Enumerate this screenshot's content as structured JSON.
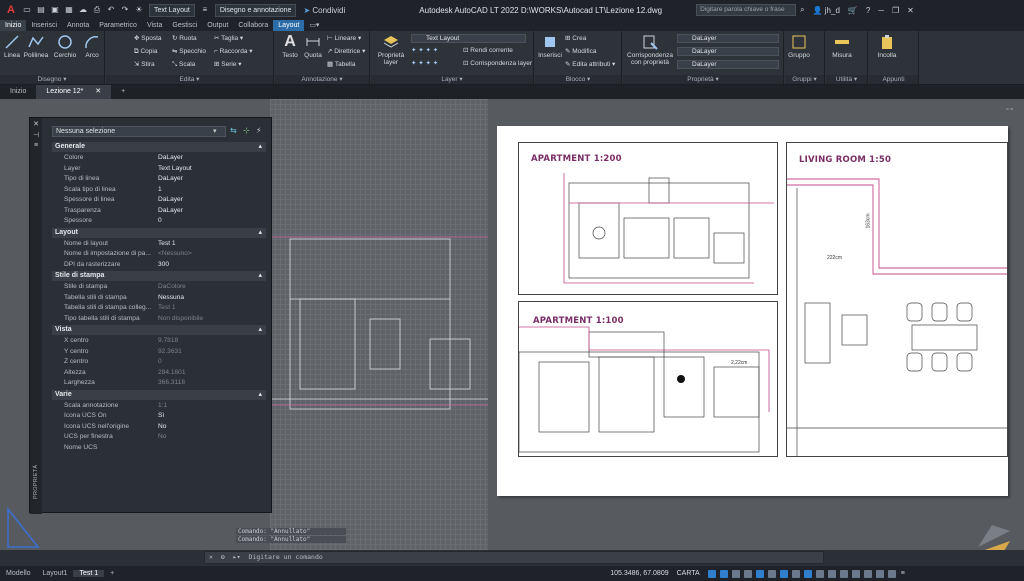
{
  "quick_access": {
    "workspace": "Text Layout",
    "mode": "Disegno e annotazione",
    "share": "Condividi"
  },
  "title": "Autodesk AutoCAD LT 2022   D:\\WORKS\\Autocad LT\\Lezione 12.dwg",
  "search_placeholder": "Digitare parola chiave o frase",
  "user": "jh_d",
  "ribbon_tabs": [
    "Inizio",
    "Inserisci",
    "Annota",
    "Parametrico",
    "Vista",
    "Gestisci",
    "Output",
    "Collabora",
    "Layout"
  ],
  "ribbon": {
    "disegno": {
      "label": "Disegno",
      "tools": [
        "Linea",
        "Polilinea",
        "Cerchio",
        "Arco"
      ]
    },
    "edita": {
      "label": "Edita",
      "tools": [
        "Sposta",
        "Ruota",
        "Taglia",
        "Copia",
        "Specchio",
        "Raccorda",
        "Stira",
        "Scala",
        "Serie"
      ]
    },
    "annotazione": {
      "label": "Annotazione",
      "tools": [
        "Testo",
        "Quota",
        "Lineare",
        "Direttrice",
        "Tabella"
      ]
    },
    "layer": {
      "label": "Layer",
      "big": "Proprietà layer",
      "current": "Text Layout",
      "tools": [
        "Rendi corrente",
        "Corrispondenza layer"
      ]
    },
    "blocco": {
      "label": "Blocco",
      "big": "Inserisci",
      "tools": [
        "Crea",
        "Modifica",
        "Edita attributi"
      ]
    },
    "proprieta": {
      "label": "Proprietà",
      "big": "Corrispondenza con proprietà",
      "values": [
        "DaLayer",
        "DaLayer",
        "DaLayer"
      ]
    },
    "gruppi": {
      "label": "Gruppi",
      "big": "Gruppo"
    },
    "utilita": {
      "label": "Utilità",
      "big": "Misura"
    },
    "appunti": {
      "label": "Appunti",
      "big": "Incolla"
    }
  },
  "doc_tabs": [
    "Inizio",
    "Lezione 12*"
  ],
  "properties": {
    "selection": "Nessuna selezione",
    "side_label": "PROPRIETÀ",
    "sections": [
      {
        "title": "Generale",
        "rows": [
          [
            "Colore",
            "DaLayer"
          ],
          [
            "Layer",
            "Text Layout"
          ],
          [
            "Tipo di linea",
            "DaLayer"
          ],
          [
            "Scala tipo di linea",
            "1"
          ],
          [
            "Spessore di linea",
            "DaLayer"
          ],
          [
            "Trasparenza",
            "DaLayer"
          ],
          [
            "Spessore",
            "0"
          ]
        ]
      },
      {
        "title": "Layout",
        "rows": [
          [
            "Nome di layout",
            "Test 1"
          ],
          [
            "Nome di impostazione di pa...",
            "<Nessuno>"
          ],
          [
            "DPI da rasterizzare",
            "300"
          ]
        ]
      },
      {
        "title": "Stile di stampa",
        "rows": [
          [
            "Stile di stampa",
            "DaColore"
          ],
          [
            "Tabella stili di stampa",
            "Nessuna"
          ],
          [
            "Tabella stili di stampa colleg...",
            "Test 1"
          ],
          [
            "Tipo tabella stili di stampa",
            "Non disponibile"
          ]
        ]
      },
      {
        "title": "Vista",
        "rows": [
          [
            "X centro",
            "9.7818"
          ],
          [
            "Y centro",
            "92.3631"
          ],
          [
            "Z centro",
            "0"
          ],
          [
            "Altezza",
            "284.1601"
          ],
          [
            "Larghezza",
            "366.3118"
          ]
        ]
      },
      {
        "title": "Varie",
        "rows": [
          [
            "Scala annotazione",
            "1:1"
          ],
          [
            "Icona UCS On",
            "Sì"
          ],
          [
            "Icona UCS nell'origine",
            "No"
          ],
          [
            "UCS per finestra",
            "No"
          ],
          [
            "Nome UCS",
            ""
          ]
        ]
      }
    ]
  },
  "viewports": {
    "a200": "APARTMENT 1:200",
    "a100": "APARTMENT 1:100",
    "living": "LIVING ROOM 1:50",
    "dim_163": "163cm",
    "dim_222": "222cm",
    "dim_22": "2,22cm"
  },
  "command_history": [
    "Comando: \"Annullato\"",
    "Comando: \"Annullato\""
  ],
  "command_placeholder": "Digitare un comando",
  "layout_tabs": [
    "Modello",
    "Layout1",
    "Test 1"
  ],
  "coords": "105.3486, 67.0809",
  "space": "CARTA"
}
